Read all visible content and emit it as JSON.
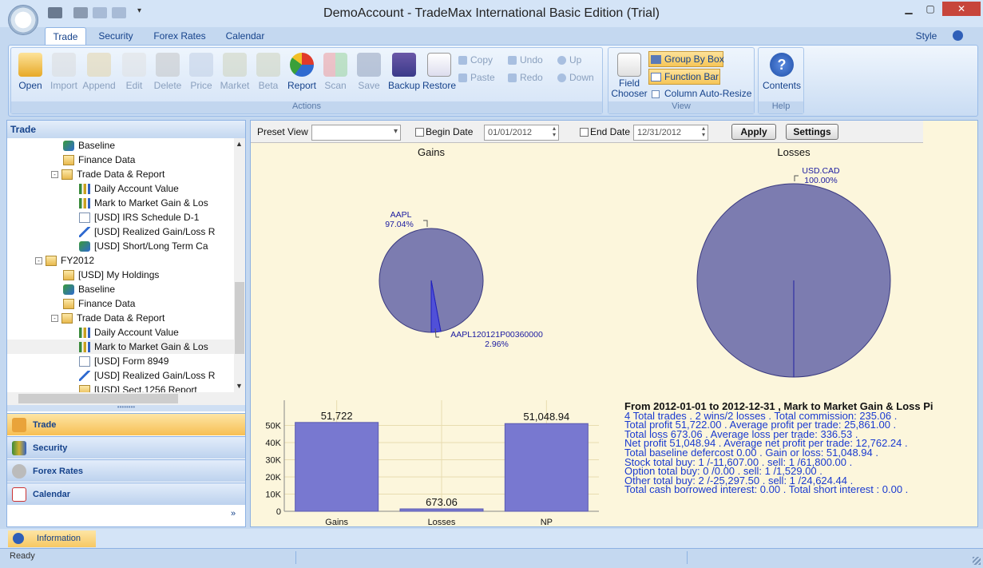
{
  "window": {
    "title": "DemoAccount - TradeMax International Basic Edition (Trial)"
  },
  "ribbon_tabs": [
    "Trade",
    "Security",
    "Forex Rates",
    "Calendar"
  ],
  "style_menu": "Style",
  "actions": {
    "open": "Open",
    "import": "Import",
    "append": "Append",
    "edit": "Edit",
    "delete": "Delete",
    "price": "Price",
    "market": "Market",
    "beta": "Beta",
    "report": "Report",
    "scan": "Scan",
    "save": "Save",
    "backup": "Backup",
    "restore": "Restore",
    "copy": "Copy",
    "paste": "Paste",
    "undo": "Undo",
    "redo": "Redo",
    "up": "Up",
    "down": "Down",
    "caption": "Actions"
  },
  "view": {
    "field_chooser": "Field Chooser",
    "group_by_box": "Group By Box",
    "function_bar": "Function Bar",
    "column_auto_resize": "Column Auto-Resize",
    "caption": "View"
  },
  "help": {
    "contents": "Contents",
    "caption": "Help"
  },
  "left_panel": {
    "header": "Trade",
    "tree": [
      {
        "label": "Baseline",
        "icon": "cube",
        "indent": 3
      },
      {
        "label": "Finance Data",
        "icon": "fold",
        "indent": 3
      },
      {
        "label": "Trade Data & Report",
        "icon": "fold",
        "indent": 3,
        "exp": "-"
      },
      {
        "label": "Daily Account Value",
        "icon": "bar",
        "indent": 4
      },
      {
        "label": "Mark to Market Gain & Los",
        "icon": "bar",
        "indent": 4
      },
      {
        "label": "[USD] IRS Schedule D-1",
        "icon": "doc",
        "indent": 4
      },
      {
        "label": "[USD] Realized Gain/Loss R",
        "icon": "line",
        "indent": 4
      },
      {
        "label": "[USD] Short/Long Term Ca",
        "icon": "cube",
        "indent": 4
      },
      {
        "label": "FY2012",
        "icon": "fold",
        "indent": 2,
        "exp": "-"
      },
      {
        "label": "[USD] My Holdings",
        "icon": "fold",
        "indent": 3
      },
      {
        "label": "Baseline",
        "icon": "cube",
        "indent": 3
      },
      {
        "label": "Finance Data",
        "icon": "fold",
        "indent": 3
      },
      {
        "label": "Trade Data & Report",
        "icon": "fold",
        "indent": 3,
        "exp": "-"
      },
      {
        "label": "Daily Account Value",
        "icon": "bar",
        "indent": 4
      },
      {
        "label": "Mark to Market Gain & Los",
        "icon": "bar",
        "indent": 4
      },
      {
        "label": "[USD] Form 8949",
        "icon": "doc",
        "indent": 4
      },
      {
        "label": "[USD] Realized Gain/Loss R",
        "icon": "line",
        "indent": 4
      },
      {
        "label": "[USD] Sect.1256 Report",
        "icon": "fold",
        "indent": 4
      }
    ],
    "nav": [
      "Trade",
      "Security",
      "Forex Rates",
      "Calendar"
    ]
  },
  "toolbar": {
    "preset_view": "Preset View",
    "begin_date_label": "Begin Date",
    "begin_date": "01/01/2012",
    "end_date_label": "End Date",
    "end_date": "12/31/2012",
    "apply": "Apply",
    "settings": "Settings"
  },
  "chart_data": [
    {
      "type": "pie",
      "title": "Gains",
      "labels": [
        "AAPL",
        "AAPL120121P00360000"
      ],
      "values": [
        97.04,
        2.96
      ],
      "value_labels": [
        "97.04%",
        "2.96%"
      ]
    },
    {
      "type": "pie",
      "title": "Losses",
      "labels": [
        "USD.CAD"
      ],
      "values": [
        100.0
      ],
      "value_labels": [
        "100.00%"
      ]
    },
    {
      "type": "bar",
      "categories": [
        "Gains",
        "Losses",
        "NP"
      ],
      "values": [
        51722,
        673.06,
        51048.94
      ],
      "value_labels": [
        "51,722",
        "673.06",
        "51,048.94"
      ],
      "ylim": [
        0,
        60000
      ],
      "yticks": [
        "0",
        "10K",
        "20K",
        "30K",
        "40K",
        "50K"
      ],
      "grid": true
    }
  ],
  "colors": {
    "slice": "#7c7cb0",
    "bar": "#7878d0",
    "text_blue": "#1a3ad0"
  },
  "stats": {
    "heading": "From 2012-01-01 to 2012-12-31 , Mark to Market Gain & Loss Pi",
    "lines": [
      "4 Total trades . 2 wins/2 losses . Total commission: 235.06 .",
      "Total profit 51,722.00 . Average profit per trade: 25,861.00 .",
      "Total loss 673.06 . Average loss per trade: 336.53 .",
      "Net profit 51,048.94 . Average net profit per trade: 12,762.24 .",
      "Total baseline defercost 0.00 . Gain or loss: 51,048.94 .",
      "Stock total buy: 1 /-11,607.00 . sell: 1 /61,800.00 .",
      "Option total buy: 0 /0.00 . sell: 1 /1,529.00 .",
      "Other total buy: 2 /-25,297.50 . sell: 1 /24,624.44 .",
      "Total cash borrowed interest: 0.00 . Total short interest : 0.00 ."
    ]
  },
  "info_tab": "Information",
  "status": "Ready"
}
